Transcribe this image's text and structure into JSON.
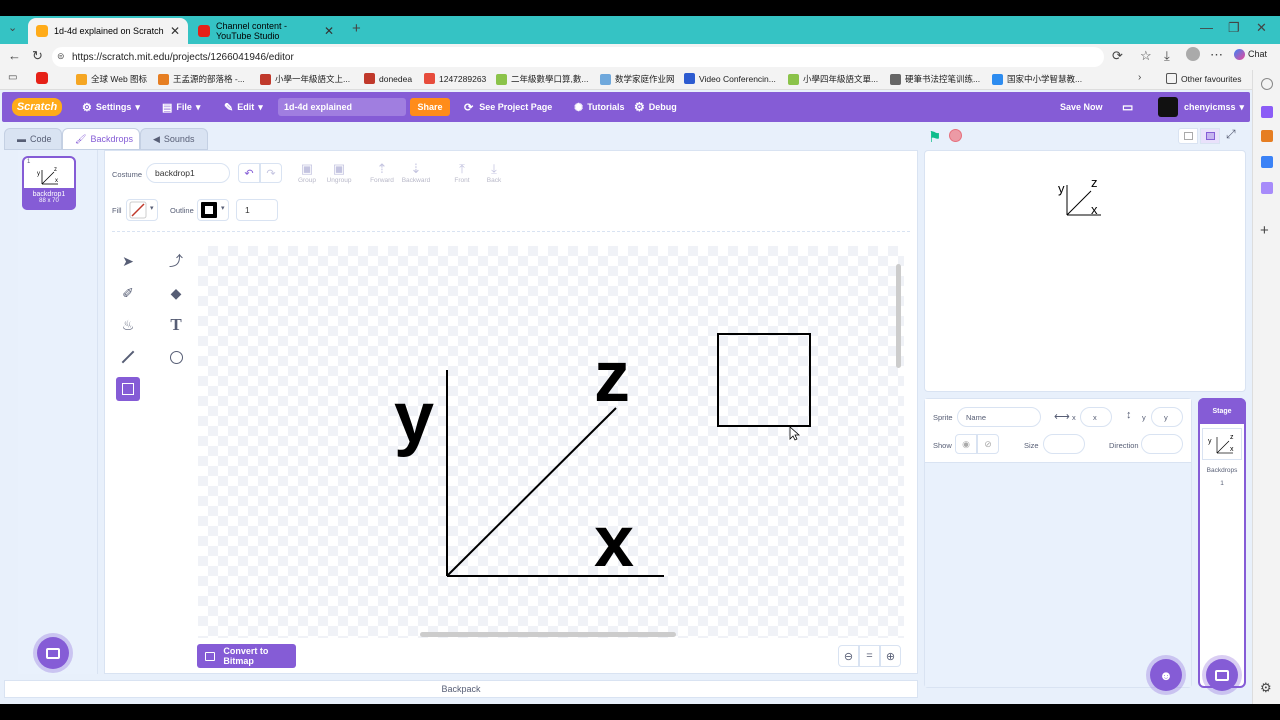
{
  "browser": {
    "tabs": [
      {
        "label": "1d-4d explained on Scratch",
        "active": true,
        "color": "#ffab19"
      },
      {
        "label": "Channel content - YouTube Studio",
        "active": false,
        "color": "#e62117"
      }
    ],
    "url": "https://scratch.mit.edu/projects/1266041946/editor",
    "bookmarks": [
      {
        "label": "全球 Web 图标",
        "color": "#f5a623"
      },
      {
        "label": "王孟源的部落格 -...",
        "color": "#e67e22"
      },
      {
        "label": "小學一年級語文上...",
        "color": "#c0392b"
      },
      {
        "label": "donedea",
        "color": "#c0392b"
      },
      {
        "label": "1247289263",
        "color": "#e74c3c"
      },
      {
        "label": "二年級數學口算,數...",
        "color": "#8bc34a"
      },
      {
        "label": "数学家庭作业网",
        "color": "#6fa8dc"
      },
      {
        "label": "Video Conferencin...",
        "color": "#2d5bd0"
      },
      {
        "label": "小學四年級語文單...",
        "color": "#8bc34a"
      },
      {
        "label": "硬筆书法控笔训练...",
        "color": "#666666"
      },
      {
        "label": "国家中小学智慧教...",
        "color": "#2d8cf0"
      }
    ],
    "other_favourites": "Other favourites",
    "chat": "Chat"
  },
  "scratch": {
    "logo": "Scratch",
    "menu": {
      "settings": "Settings",
      "file": "File",
      "edit": "Edit",
      "project_title": "1d-4d explained",
      "share": "Share",
      "see_project_page": "See Project Page",
      "tutorials": "Tutorials",
      "debug": "Debug",
      "save_now": "Save Now",
      "username": "chenyicmss"
    },
    "editor_tabs": {
      "code": "Code",
      "backdrops": "Backdrops",
      "sounds": "Sounds"
    },
    "costume_list": [
      {
        "index": "1",
        "name": "backdrop1",
        "size": "88 x 70"
      }
    ],
    "paint": {
      "costume_label": "Costume",
      "costume_name": "backdrop1",
      "toolbar": [
        "Group",
        "Ungroup",
        "Forward",
        "Backward",
        "Front",
        "Back"
      ],
      "fill_label": "Fill",
      "outline_label": "Outline",
      "outline_width": "1",
      "convert_button": "Convert to Bitmap",
      "canvas_labels": {
        "y": "y",
        "z": "z",
        "x": "x"
      }
    },
    "stage_labels": {
      "y": "y",
      "z": "z",
      "x": "x"
    },
    "sprite_info": {
      "sprite_label": "Sprite",
      "name_placeholder": "Name",
      "x_label": "x",
      "x_placeholder": "x",
      "y_label": "y",
      "y_placeholder": "y",
      "show_label": "Show",
      "size_label": "Size",
      "direction_label": "Direction"
    },
    "stage_pane": {
      "title": "Stage",
      "backdrops_label": "Backdrops",
      "backdrops_count": "1"
    },
    "backpack": "Backpack"
  }
}
